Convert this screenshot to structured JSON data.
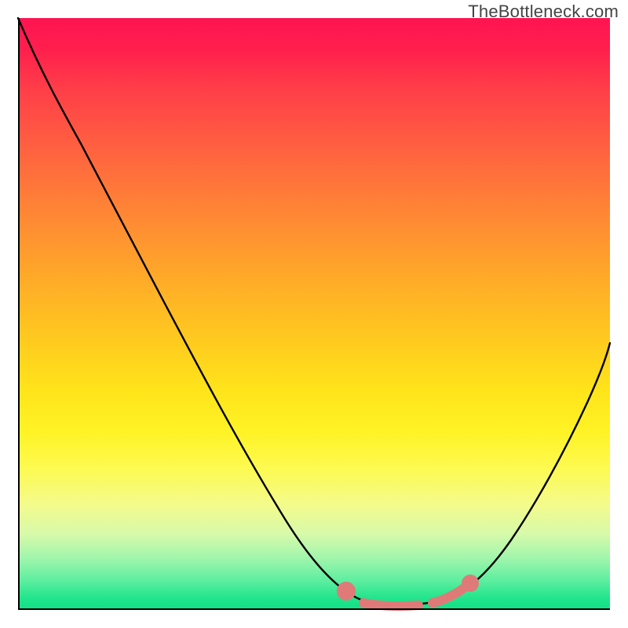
{
  "watermark": "TheBottleneck.com",
  "chart_data": {
    "type": "line",
    "title": "",
    "xlabel": "",
    "ylabel": "",
    "xlim": [
      0,
      100
    ],
    "ylim": [
      0,
      100
    ],
    "grid": false,
    "legend": false,
    "background_gradient": {
      "top": "#ff1452",
      "bottom": "#10e086",
      "meaning": "red-high-bottleneck to green-low-bottleneck"
    },
    "series": [
      {
        "name": "bottleneck-curve",
        "color": "#000000",
        "x": [
          0,
          5,
          10,
          15,
          20,
          25,
          30,
          35,
          40,
          45,
          50,
          54,
          58,
          62,
          66,
          70,
          74,
          78,
          82,
          86,
          90,
          94,
          98,
          100
        ],
        "values": [
          100,
          93,
          85,
          77,
          69,
          61,
          53,
          45,
          37,
          29,
          21,
          14,
          8,
          4,
          2,
          2,
          2,
          3,
          6,
          12,
          20,
          30,
          41,
          47
        ]
      },
      {
        "name": "sweet-spot-highlight",
        "color": "#e07a78",
        "x": [
          58,
          60,
          63,
          66,
          69,
          72,
          75,
          78
        ],
        "values": [
          6,
          4,
          3,
          3,
          3,
          3,
          4,
          6
        ]
      }
    ]
  }
}
